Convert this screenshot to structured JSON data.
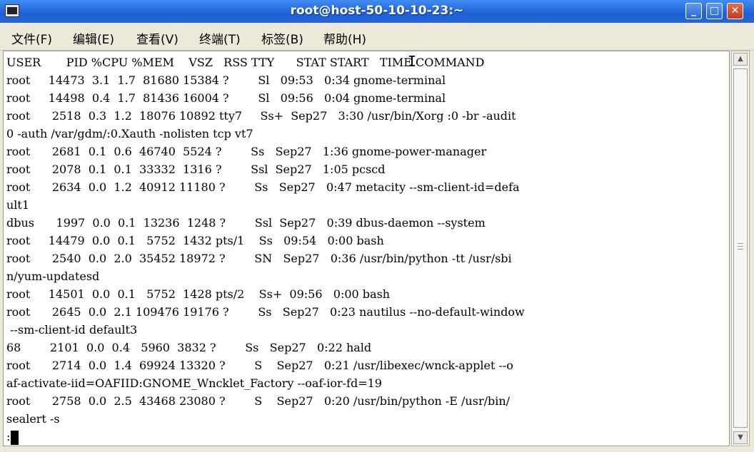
{
  "window": {
    "title": "root@host-50-10-10-23:~"
  },
  "menu": [
    "文件(F)",
    "编辑(E)",
    "查看(V)",
    "终端(T)",
    "标签(B)",
    "帮助(H)"
  ],
  "terminal": {
    "lines": [
      "USER       PID %CPU %MEM    VSZ   RSS TTY      STAT START   TIME COMMAND",
      "root     14473  3.1  1.7  81680 15384 ?        Sl   09:53   0:34 gnome-terminal",
      "root     14498  0.4  1.7  81436 16004 ?        Sl   09:56   0:04 gnome-terminal",
      "root      2518  0.3  1.2  18076 10892 tty7     Ss+  Sep27   3:30 /usr/bin/Xorg :0 -br -audit",
      "0 -auth /var/gdm/:0.Xauth -nolisten tcp vt7",
      "root      2681  0.1  0.6  46740  5524 ?        Ss   Sep27   1:36 gnome-power-manager",
      "root      2078  0.1  0.1  33332  1316 ?        Ssl  Sep27   1:05 pcscd",
      "root      2634  0.0  1.2  40912 11180 ?        Ss   Sep27   0:47 metacity --sm-client-id=defa",
      "ult1",
      "dbus      1997  0.0  0.1  13236  1248 ?        Ssl  Sep27   0:39 dbus-daemon --system",
      "root     14479  0.0  0.1   5752  1432 pts/1    Ss   09:54   0:00 bash",
      "root      2540  0.0  2.0  35452 18972 ?        SN   Sep27   0:36 /usr/bin/python -tt /usr/sbi",
      "n/yum-updatesd",
      "root     14501  0.0  0.1   5752  1428 pts/2    Ss+  09:56   0:00 bash",
      "root      2645  0.0  2.1 109476 19176 ?        Ss   Sep27   0:23 nautilus --no-default-window",
      " --sm-client-id default3",
      "68        2101  0.0  0.4   5960  3832 ?        Ss   Sep27   0:22 hald",
      "root      2714  0.0  1.4  69924 13320 ?        S    Sep27   0:21 /usr/libexec/wnck-applet --o",
      "af-activate-iid=OAFIID:GNOME_Wncklet_Factory --oaf-ior-fd=19",
      "root      2758  0.0  2.5  43468 23080 ?        S    Sep27   0:20 /usr/bin/python -E /usr/bin/",
      "sealert -s"
    ],
    "prompt": ":"
  },
  "colors": {
    "titlebar": "#2a6fe0",
    "menubar": "#ece9d8",
    "terminal_bg": "#ffffff"
  }
}
